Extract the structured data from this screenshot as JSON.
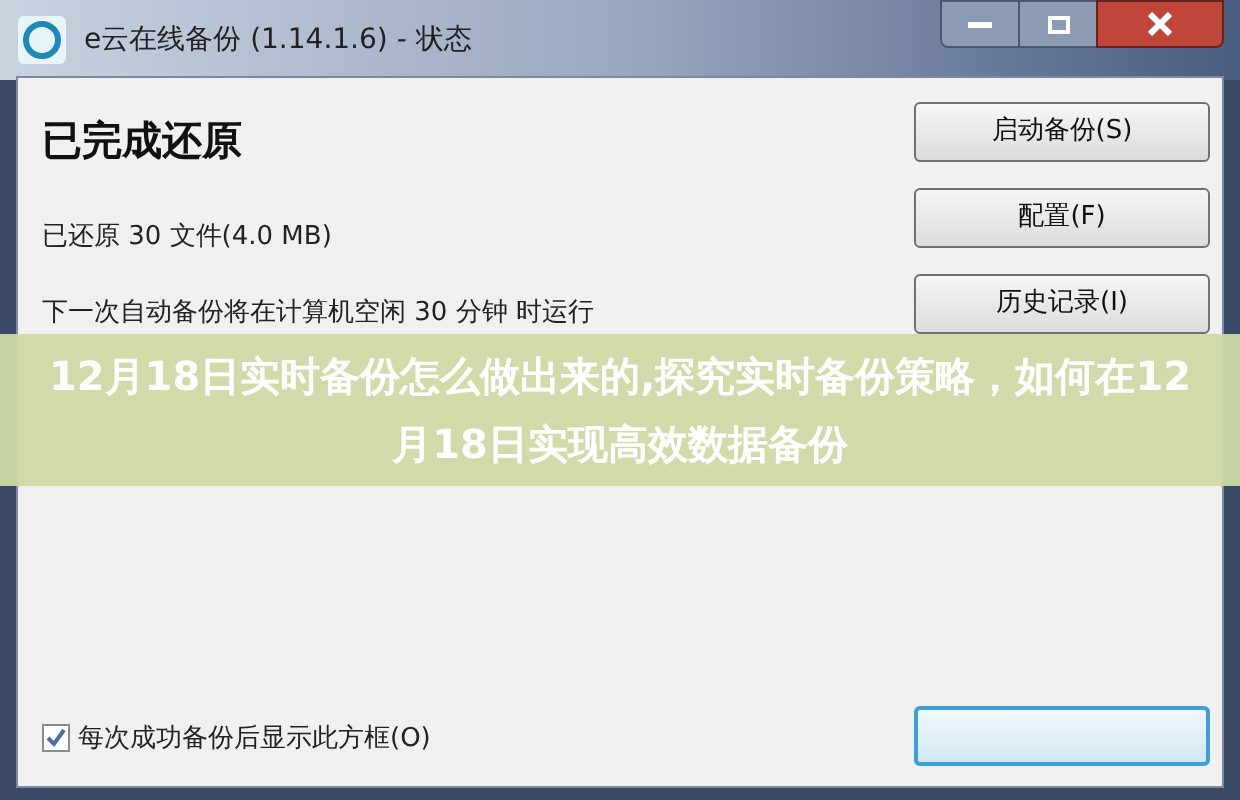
{
  "window": {
    "title": "e云在线备份 (1.14.1.6) - 状态"
  },
  "heading": "已完成还原",
  "status_lines": [
    "已还原 30 文件(4.0 MB)",
    "下一次自动备份将在计算机空闲 30 分钟 时运行"
  ],
  "buttons": [
    {
      "label": "启动备份(S)"
    },
    {
      "label": "配置(F)"
    },
    {
      "label": "历史记录(I)"
    }
  ],
  "show_after_backup": {
    "label": "每次成功备份后显示此方框(O)",
    "checked": true
  },
  "banner": {
    "text": "12月18日实时备份怎么做出来的,探究实时备份策略，如何在12月18日实现高效数据备份"
  }
}
